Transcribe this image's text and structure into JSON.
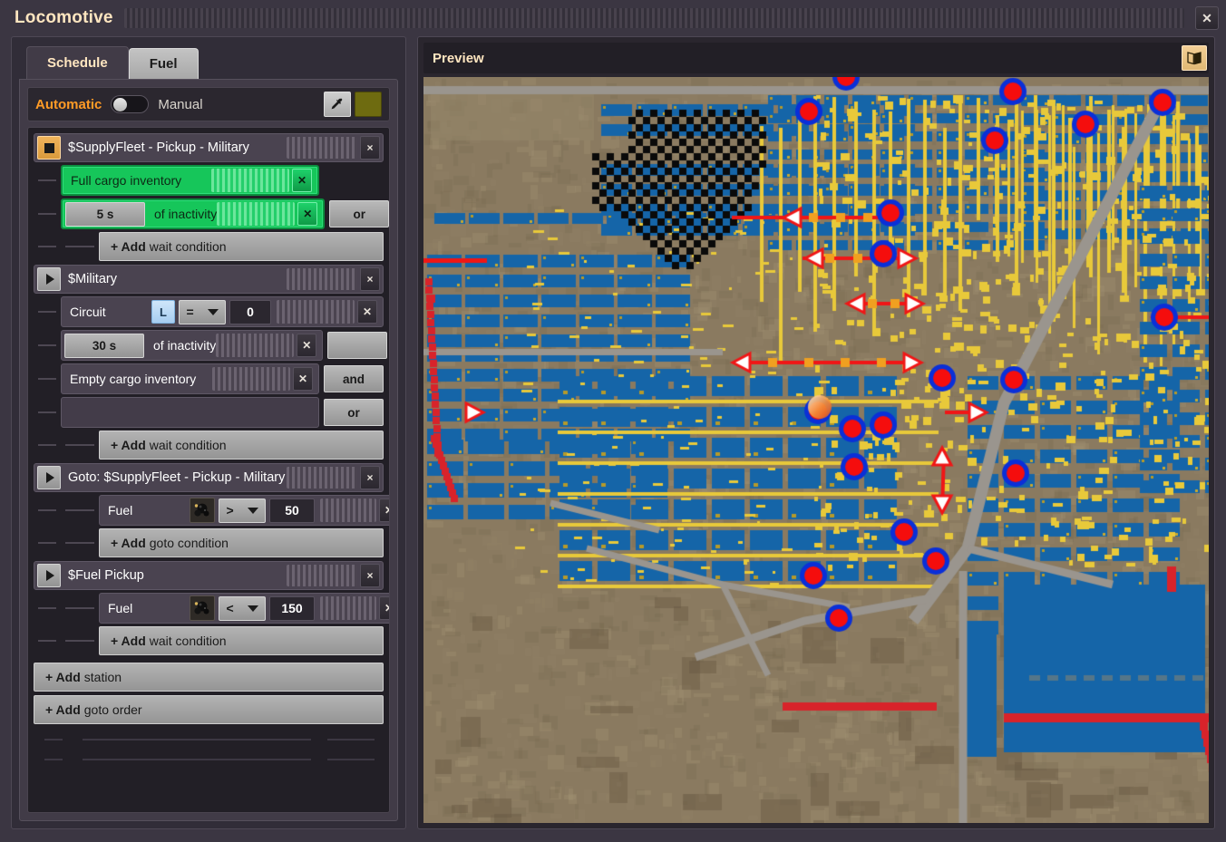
{
  "window": {
    "title": "Locomotive",
    "close_icon": "close-icon"
  },
  "tabs": [
    {
      "label": "Schedule",
      "active": true
    },
    {
      "label": "Fuel",
      "active": false
    }
  ],
  "mode": {
    "automatic_label": "Automatic",
    "manual_label": "Manual",
    "selected": "Automatic",
    "pipette_icon": "pipette-icon",
    "color_swatch": "#6e6b10"
  },
  "schedule": {
    "entries": [
      {
        "type": "station",
        "icon": "stop-square-icon",
        "active": true,
        "name": "$SupplyFleet - Pickup - Military",
        "close_label": "×",
        "conditions": [
          {
            "kind": "simple",
            "highlight": true,
            "text": "Full cargo inventory",
            "logic": null
          },
          {
            "kind": "time",
            "highlight": true,
            "time_value": "5 s",
            "text": "of inactivity",
            "logic": "or"
          }
        ],
        "add_label_prefix": "+ Add",
        "add_label_rest": "wait condition"
      },
      {
        "type": "station",
        "icon": "play-triangle-icon",
        "active": false,
        "name": "$Military",
        "close_label": "×",
        "conditions": [
          {
            "kind": "circuit",
            "highlight": false,
            "text": "Circuit",
            "signal": "L",
            "operator": "=",
            "value": "0",
            "logic": null
          },
          {
            "kind": "time",
            "highlight": false,
            "time_value": "30 s",
            "text": "of inactivity",
            "logic": ""
          },
          {
            "kind": "simple",
            "highlight": false,
            "text": "Empty cargo inventory",
            "logic": "and"
          },
          {
            "kind": "blank",
            "highlight": false,
            "text": "",
            "logic": "or"
          }
        ],
        "add_label_prefix": "+ Add",
        "add_label_rest": "wait condition"
      },
      {
        "type": "goto",
        "icon": "play-triangle-icon",
        "active": false,
        "name": "Goto: $SupplyFleet - Pickup - Military",
        "close_label": "×",
        "conditions": [
          {
            "kind": "item",
            "highlight": false,
            "text": "Fuel",
            "item_icon": "coal-icon",
            "operator": ">",
            "value": "50",
            "logic": null
          }
        ],
        "add_label_prefix": "+ Add",
        "add_label_rest": "goto condition"
      },
      {
        "type": "station",
        "icon": "play-triangle-icon",
        "active": false,
        "name": "$Fuel Pickup",
        "close_label": "×",
        "conditions": [
          {
            "kind": "item",
            "highlight": false,
            "text": "Fuel",
            "item_icon": "coal-icon",
            "operator": "<",
            "value": "150",
            "logic": null
          }
        ],
        "add_label_prefix": "+ Add",
        "add_label_rest": "wait condition"
      }
    ],
    "add_station_prefix": "+ Add",
    "add_station_rest": "station",
    "add_goto_prefix": "+ Add",
    "add_goto_rest": "goto order"
  },
  "preview": {
    "title": "Preview",
    "map_icon": "map-book-icon",
    "map": {
      "terrain_color": "#8a7a60",
      "water_color": "#1565a8",
      "belt_color": "#e8c93a",
      "road_color": "#9a958e",
      "wall_color": "#d8232a",
      "station_marker_fill": "#f50d0d",
      "station_marker_ring": "#0a2fd8",
      "route_line_color": "#f01616",
      "waypoint_color": "#f0a020",
      "train_marker_color": "#f08828"
    }
  }
}
